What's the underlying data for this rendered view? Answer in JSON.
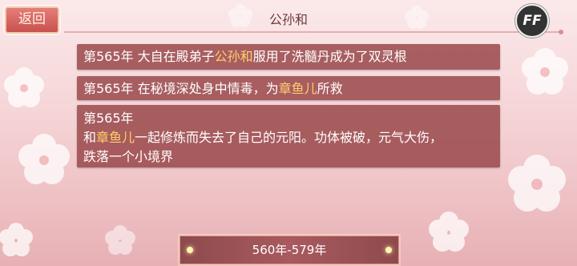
{
  "header": {
    "back_label": "返回",
    "title": "公孙和",
    "ff_label": "FF"
  },
  "events": [
    {
      "year": "第565年",
      "pre": " 大自在殿弟子",
      "highlight": "公孙和",
      "post": "服用了洗髓丹成为了双灵根"
    },
    {
      "year": "第565年",
      "pre": " 在秘境深处身中情毒，为",
      "highlight": "章鱼儿",
      "post": "所救"
    },
    {
      "year": "第565年",
      "line1_pre": "和",
      "line1_highlight": "章鱼儿",
      "line1_post": "一起修炼而失去了自己的元阳。功体被破，元气大伤，",
      "line2": "跌落一个小境界"
    }
  ],
  "footer": {
    "year_range": "560年-579年"
  },
  "colors": {
    "highlight": "#ffd06a",
    "row_bg": "#964244",
    "accent": "#c9514f"
  }
}
